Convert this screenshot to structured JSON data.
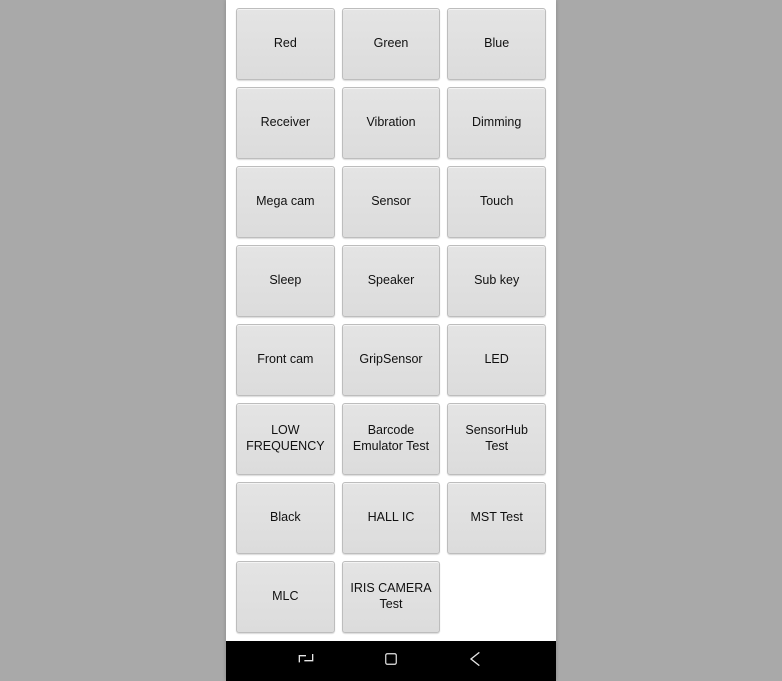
{
  "grid": {
    "rows": [
      [
        "Red",
        "Green",
        "Blue"
      ],
      [
        "Receiver",
        "Vibration",
        "Dimming"
      ],
      [
        "Mega cam",
        "Sensor",
        "Touch"
      ],
      [
        "Sleep",
        "Speaker",
        "Sub key"
      ],
      [
        "Front cam",
        "GripSensor",
        "LED"
      ],
      [
        "LOW FREQUENCY",
        "Barcode Emulator Test",
        "SensorHub Test"
      ],
      [
        "Black",
        "HALL IC",
        "MST Test"
      ],
      [
        "MLC",
        "IRIS CAMERA Test"
      ]
    ]
  },
  "nav": {
    "recent": "recent-apps",
    "home": "home",
    "back": "back"
  }
}
